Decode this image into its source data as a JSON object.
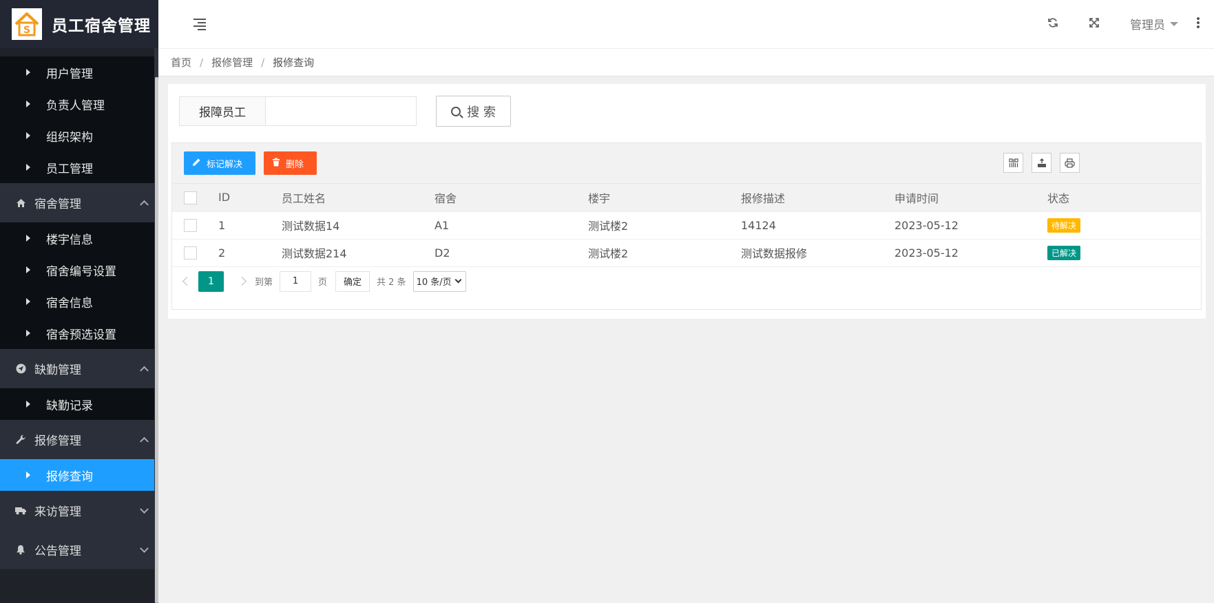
{
  "app": {
    "title": "员工宿舍管理",
    "logo_letter": "S"
  },
  "sidebar": {
    "top_items": [
      "用户管理",
      "负责人管理",
      "组织架构",
      "员工管理"
    ],
    "groups": [
      {
        "label": "宿舍管理",
        "icon": "home-icon",
        "expanded": true,
        "items": [
          "楼宇信息",
          "宿舍编号设置",
          "宿舍信息",
          "宿舍预选设置"
        ]
      },
      {
        "label": "缺勤管理",
        "icon": "send-icon",
        "expanded": true,
        "items": [
          "缺勤记录"
        ]
      },
      {
        "label": "报修管理",
        "icon": "wrench-icon",
        "expanded": true,
        "items": [
          "报修查询"
        ],
        "active_item": "报修查询"
      },
      {
        "label": "来访管理",
        "icon": "truck-icon",
        "expanded": false,
        "items": []
      },
      {
        "label": "公告管理",
        "icon": "bell-icon",
        "expanded": false,
        "items": []
      }
    ]
  },
  "header": {
    "user": "管理员",
    "icons": [
      "refresh-icon",
      "fullscreen-icon",
      "more-icon"
    ]
  },
  "breadcrumb": [
    "首页",
    "报修管理",
    "报修查询"
  ],
  "search": {
    "label": "报障员工",
    "value": "",
    "button": "搜 索"
  },
  "toolbar": {
    "resolve": "标记解决",
    "delete": "删除",
    "right_icons": [
      "columns-icon",
      "export-icon",
      "print-icon"
    ]
  },
  "table": {
    "columns": [
      "ID",
      "员工姓名",
      "宿舍",
      "楼宇",
      "报修描述",
      "申请时间",
      "状态"
    ],
    "rows": [
      {
        "id": "1",
        "name": "测试数据14",
        "dorm": "A1",
        "building": "测试楼2",
        "desc": "14124",
        "time": "2023-05-12",
        "status": "待解决",
        "status_color": "#ffb800"
      },
      {
        "id": "2",
        "name": "测试数据214",
        "dorm": "D2",
        "building": "测试楼2",
        "desc": "测试数据报修",
        "time": "2023-05-12",
        "status": "已解决",
        "status_color": "#009688"
      }
    ]
  },
  "pager": {
    "current": "1",
    "goto_label": "到第",
    "goto_value": "1",
    "page_unit": "页",
    "confirm": "确定",
    "total": "共 2 条",
    "page_size": "10 条/页"
  },
  "colors": {
    "accent_blue": "#1e9fff",
    "danger": "#ff5722",
    "teal": "#009688",
    "sidebar_bg": "#20222a"
  }
}
